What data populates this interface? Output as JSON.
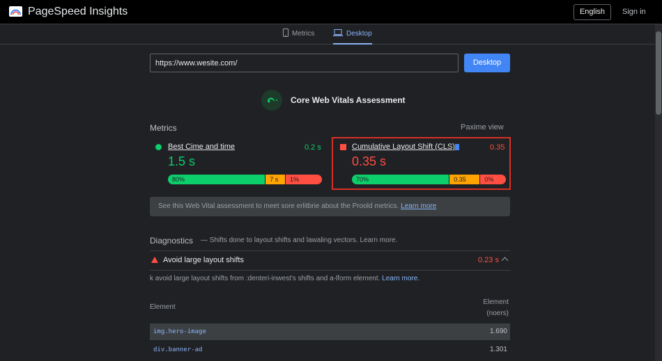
{
  "header": {
    "app_title": "PageSpeed Insights",
    "language": "English",
    "signin": "Sign in"
  },
  "tabs": [
    {
      "label": "Metrics",
      "icon": "phone-icon"
    },
    {
      "label": "Desktop",
      "icon": "laptop-icon",
      "active": true
    }
  ],
  "search": {
    "url_value": "https://www.wesite.com/",
    "button_label": "Desktop"
  },
  "assessment": {
    "title": "Core Web Vitals Assessment"
  },
  "metrics": {
    "section_label": "Metrics",
    "view_toggle": "Paxime view",
    "items": [
      {
        "name": "Best Cime and time",
        "value_small": "0.2 s",
        "value_big": "1.5 s",
        "status": "good",
        "distribution": [
          {
            "label": "80%",
            "share": 0.63
          },
          {
            "label": "7 s",
            "share": 0.13
          },
          {
            "label": "1%",
            "share": 0.24
          }
        ]
      },
      {
        "name": "Cumulative Layout Shift (CLS)",
        "value_small": "0.35",
        "value_big": "0.35 s",
        "status": "poor",
        "distribution": [
          {
            "label": "70%",
            "share": 0.63
          },
          {
            "label": "0.35",
            "share": 0.2
          },
          {
            "label": "0%",
            "share": 0.17
          }
        ]
      }
    ]
  },
  "info": {
    "text": "See this Web Vital assessment to meet sore erlitbrie about the Proold metrics.",
    "link": "Learn more"
  },
  "diagnostics": {
    "title": "Diagnostics",
    "desc": "— Shifts done to layout shifts and lawaling vectors. Learn more.",
    "audit": {
      "title": "Avoid large layout shifts",
      "value": "0.23 s",
      "desc": "k avoid large layout shifts from :denteri-inwest's shifts and a-lform element.",
      "link": "Learn more.",
      "col_element": "Element",
      "col_value_1": "Element",
      "col_value_2": "(noers)",
      "rows": [
        {
          "element": "img.hero-image",
          "value": "1.690"
        },
        {
          "element": "div.banner-ad",
          "value": "1.301"
        }
      ]
    }
  },
  "colors": {
    "good": "#0cce6b",
    "average": "#ffa400",
    "poor": "#ff4e42",
    "accent": "#4285f4"
  }
}
